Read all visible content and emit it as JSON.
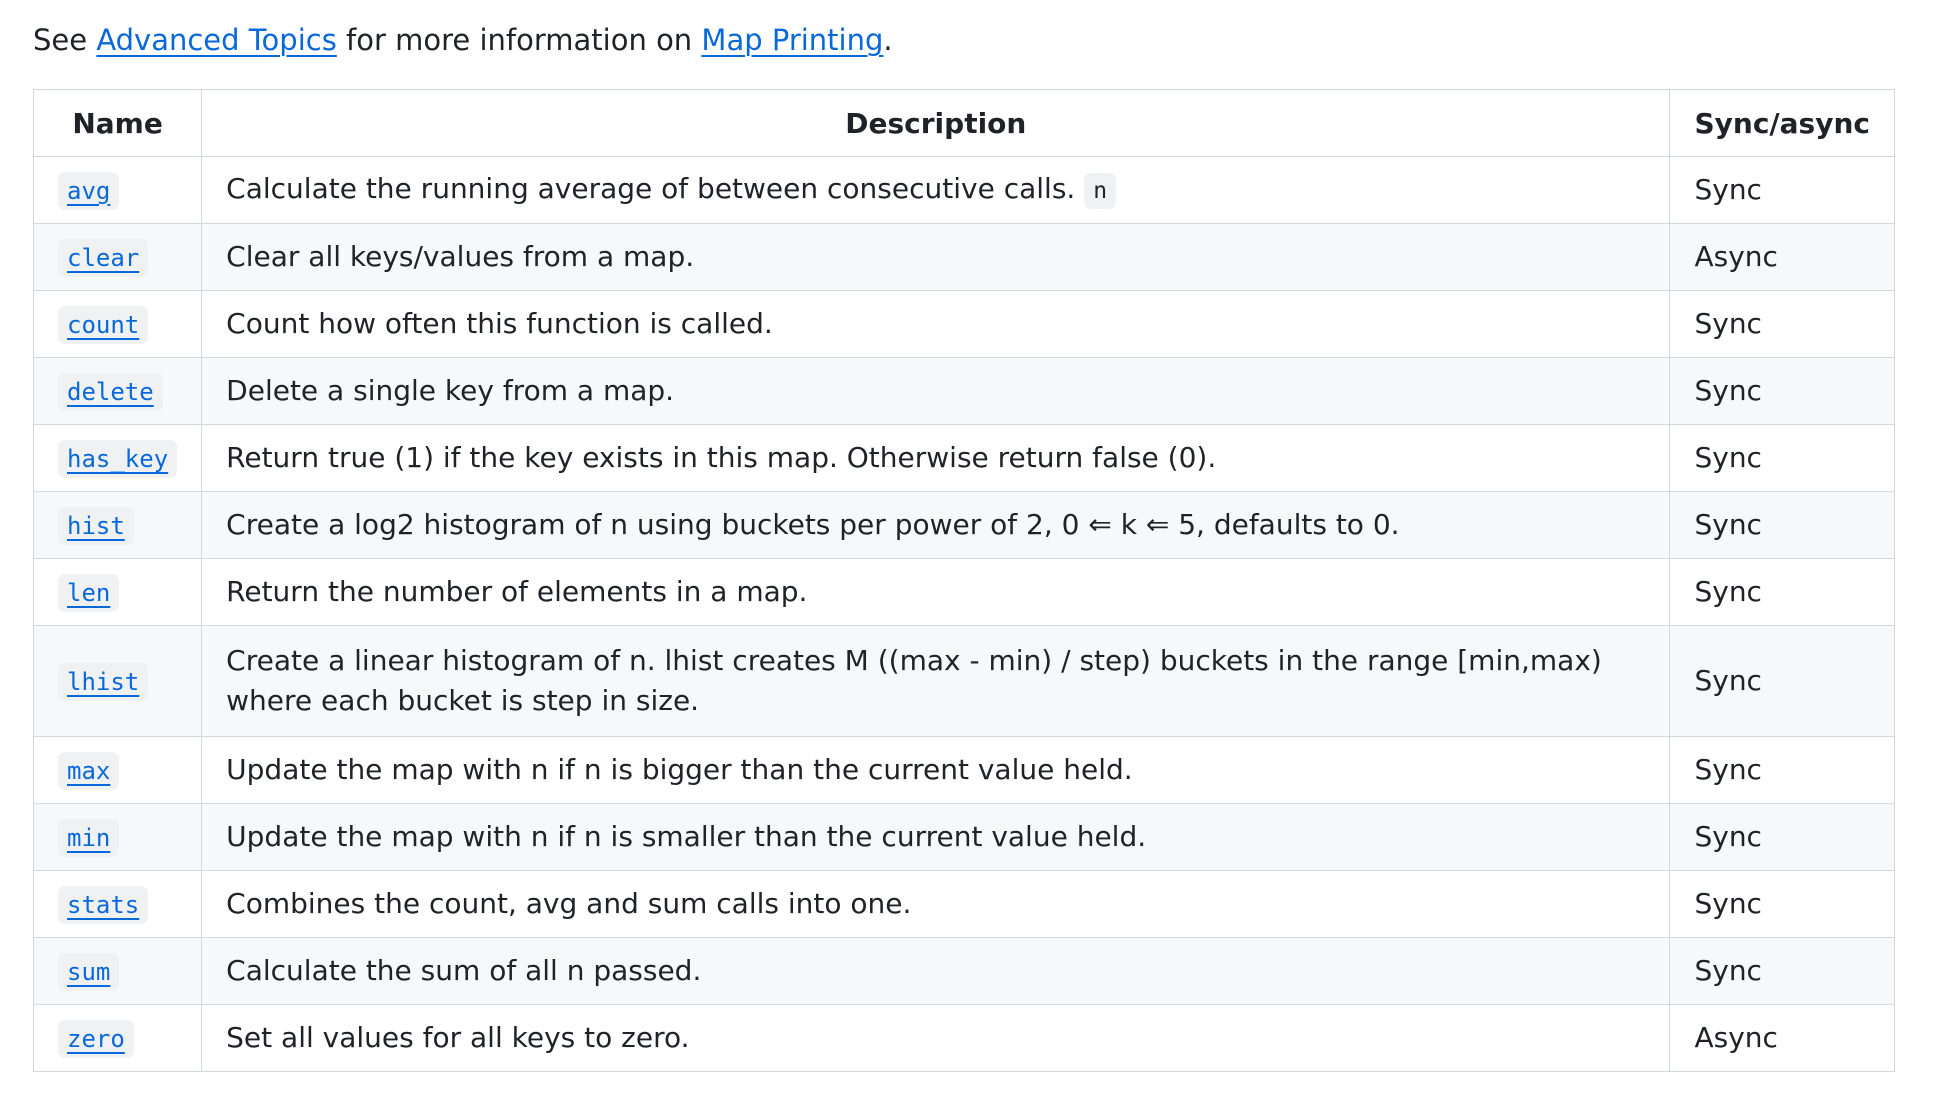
{
  "intro": {
    "prefix": "See ",
    "link1": "Advanced Topics",
    "middle": " for more information on ",
    "link2": "Map Printing",
    "suffix": "."
  },
  "table": {
    "headers": {
      "name": "Name",
      "description": "Description",
      "sync": "Sync/async"
    },
    "rows": [
      {
        "name": "avg",
        "description": "Calculate the running average of between consecutive calls. ",
        "code": "n",
        "sync": "Sync"
      },
      {
        "name": "clear",
        "description": "Clear all keys/values from a map.",
        "sync": "Async"
      },
      {
        "name": "count",
        "description": "Count how often this function is called.",
        "sync": "Sync"
      },
      {
        "name": "delete",
        "description": "Delete a single key from a map.",
        "sync": "Sync"
      },
      {
        "name": "has_key",
        "description": "Return true (1) if the key exists in this map. Otherwise return false (0).",
        "sync": "Sync"
      },
      {
        "name": "hist",
        "description": "Create a log2 histogram of n using buckets per power of 2, 0 ⇐ k ⇐ 5, defaults to 0.",
        "sync": "Sync"
      },
      {
        "name": "len",
        "description": "Return the number of elements in a map.",
        "sync": "Sync"
      },
      {
        "name": "lhist",
        "description": "Create a linear histogram of n. lhist creates M ((max - min) / step) buckets in the range [min,max) where each bucket is step in size.",
        "sync": "Sync"
      },
      {
        "name": "max",
        "description": "Update the map with n if n is bigger than the current value held.",
        "sync": "Sync"
      },
      {
        "name": "min",
        "description": "Update the map with n if n is smaller than the current value held.",
        "sync": "Sync"
      },
      {
        "name": "stats",
        "description": "Combines the count, avg and sum calls into one.",
        "sync": "Sync"
      },
      {
        "name": "sum",
        "description": "Calculate the sum of all n passed.",
        "sync": "Sync"
      },
      {
        "name": "zero",
        "description": "Set all values for all keys to zero.",
        "sync": "Async"
      }
    ]
  },
  "colors": {
    "link": "#0969da",
    "text": "#1f2328",
    "border": "#d1d9e0",
    "stripe": "#f6f8fa",
    "code_bg": "#eff1f3"
  }
}
